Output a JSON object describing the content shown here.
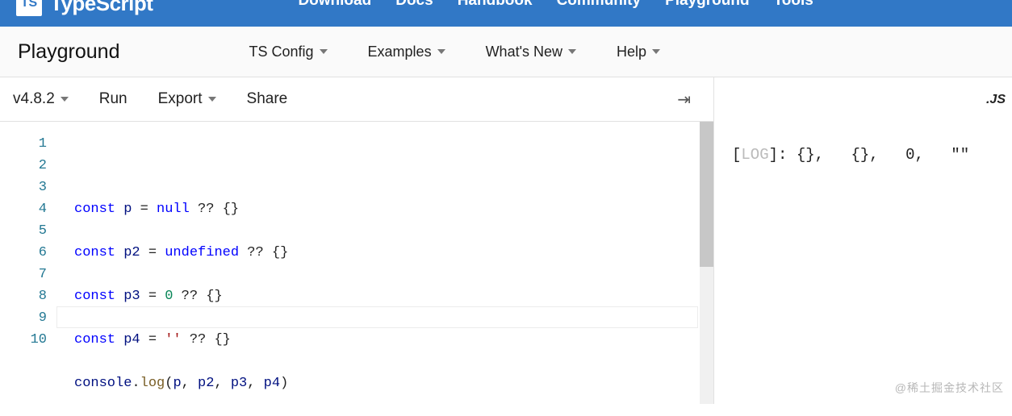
{
  "brand": {
    "logo": "TS",
    "name": "TypeScript"
  },
  "topnav": [
    "Download",
    "Docs",
    "Handbook",
    "Community",
    "Playground",
    "Tools"
  ],
  "subnav": {
    "title": "Playground",
    "items": [
      "TS Config",
      "Examples",
      "What's New",
      "Help"
    ]
  },
  "toolbar": {
    "version": "v4.8.2",
    "run": "Run",
    "export": "Export",
    "share": "Share",
    "output_label": ".JS"
  },
  "editor": {
    "line_numbers": [
      "1",
      "2",
      "3",
      "4",
      "5",
      "6",
      "7",
      "8",
      "9",
      "10"
    ],
    "highlight_line": 9,
    "lines": [
      [
        {
          "c": "kw",
          "t": "const"
        },
        {
          "c": "",
          "t": " "
        },
        {
          "c": "vr",
          "t": "p"
        },
        {
          "c": "",
          "t": " = "
        },
        {
          "c": "lt",
          "t": "null"
        },
        {
          "c": "",
          "t": " ?? {}"
        }
      ],
      [],
      [
        {
          "c": "kw",
          "t": "const"
        },
        {
          "c": "",
          "t": " "
        },
        {
          "c": "vr",
          "t": "p2"
        },
        {
          "c": "",
          "t": " = "
        },
        {
          "c": "lt",
          "t": "undefined"
        },
        {
          "c": "",
          "t": " ?? {}"
        }
      ],
      [],
      [
        {
          "c": "kw",
          "t": "const"
        },
        {
          "c": "",
          "t": " "
        },
        {
          "c": "vr",
          "t": "p3"
        },
        {
          "c": "",
          "t": " = "
        },
        {
          "c": "nm",
          "t": "0"
        },
        {
          "c": "",
          "t": " ?? {}"
        }
      ],
      [],
      [
        {
          "c": "kw",
          "t": "const"
        },
        {
          "c": "",
          "t": " "
        },
        {
          "c": "vr",
          "t": "p4"
        },
        {
          "c": "",
          "t": " = "
        },
        {
          "c": "st",
          "t": "''"
        },
        {
          "c": "",
          "t": " ?? {}"
        }
      ],
      [],
      [
        {
          "c": "vr",
          "t": "console"
        },
        {
          "c": "",
          "t": "."
        },
        {
          "c": "fn",
          "t": "log"
        },
        {
          "c": "",
          "t": "("
        },
        {
          "c": "vr",
          "t": "p"
        },
        {
          "c": "",
          "t": ", "
        },
        {
          "c": "vr",
          "t": "p2"
        },
        {
          "c": "",
          "t": ", "
        },
        {
          "c": "vr",
          "t": "p3"
        },
        {
          "c": "",
          "t": ", "
        },
        {
          "c": "vr",
          "t": "p4"
        },
        {
          "c": "",
          "t": ")"
        }
      ],
      []
    ]
  },
  "output": {
    "prefix_open": "[",
    "tag": "LOG",
    "prefix_close": "]: ",
    "values": [
      "{}",
      "{}",
      "0",
      "\"\""
    ]
  },
  "watermark": "@稀土掘金技术社区"
}
